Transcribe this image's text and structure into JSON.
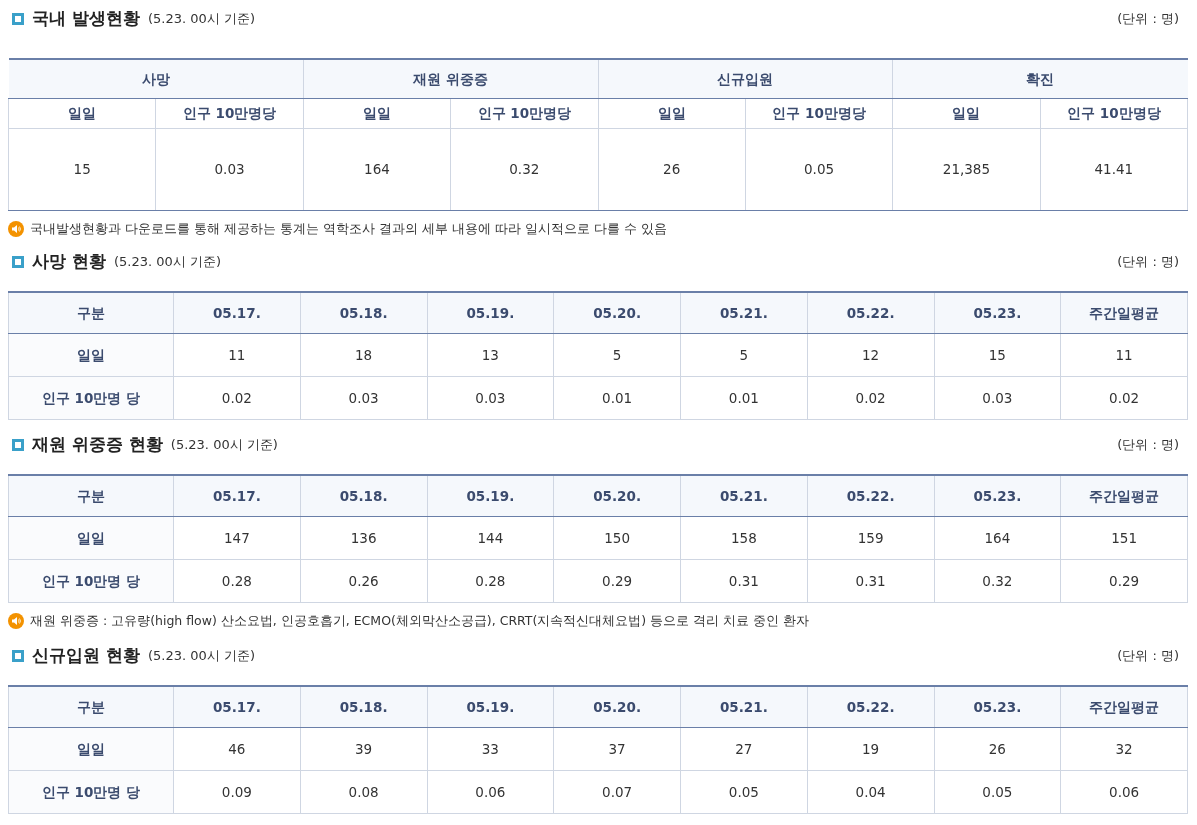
{
  "summary": {
    "title": "국내 발생현황",
    "subtitle": "(5.23. 00시 기준)",
    "unit": "(단위 : 명)",
    "groups": [
      {
        "label": "사망",
        "columns": [
          "일일",
          "인구 10만명당"
        ],
        "values": [
          "15",
          "0.03"
        ]
      },
      {
        "label": "재원 위중증",
        "columns": [
          "일일",
          "인구 10만명당"
        ],
        "values": [
          "164",
          "0.32"
        ]
      },
      {
        "label": "신규입원",
        "columns": [
          "일일",
          "인구 10만명당"
        ],
        "values": [
          "26",
          "0.05"
        ]
      },
      {
        "label": "확진",
        "columns": [
          "일일",
          "인구 10만명당"
        ],
        "values": [
          "21,385",
          "41.41"
        ]
      }
    ],
    "note": "국내발생현황과 다운로드를 통해 제공하는 통계는 역학조사 결과의 세부 내용에 따라 일시적으로 다를 수 있음"
  },
  "sections": [
    {
      "title": "사망 현황",
      "subtitle": "(5.23. 00시 기준)",
      "unit": "(단위 : 명)",
      "header": [
        "구분",
        "05.17.",
        "05.18.",
        "05.19.",
        "05.20.",
        "05.21.",
        "05.22.",
        "05.23.",
        "주간일평균"
      ],
      "rows": [
        {
          "label": "일일",
          "values": [
            "11",
            "18",
            "13",
            "5",
            "5",
            "12",
            "15",
            "11"
          ]
        },
        {
          "label": "인구 10만명 당",
          "values": [
            "0.02",
            "0.03",
            "0.03",
            "0.01",
            "0.01",
            "0.02",
            "0.03",
            "0.02"
          ]
        }
      ]
    },
    {
      "title": "재원 위중증 현황",
      "subtitle": "(5.23. 00시 기준)",
      "unit": "(단위 : 명)",
      "header": [
        "구분",
        "05.17.",
        "05.18.",
        "05.19.",
        "05.20.",
        "05.21.",
        "05.22.",
        "05.23.",
        "주간일평균"
      ],
      "rows": [
        {
          "label": "일일",
          "values": [
            "147",
            "136",
            "144",
            "150",
            "158",
            "159",
            "164",
            "151"
          ]
        },
        {
          "label": "인구 10만명 당",
          "values": [
            "0.28",
            "0.26",
            "0.28",
            "0.29",
            "0.31",
            "0.31",
            "0.32",
            "0.29"
          ]
        }
      ],
      "note": "재원 위중증 : 고유량(high flow) 산소요법, 인공호흡기, ECMO(체외막산소공급), CRRT(지속적신대체요법) 등으로 격리 치료 중인 환자"
    },
    {
      "title": "신규입원 현황",
      "subtitle": "(5.23. 00시 기준)",
      "unit": "(단위 : 명)",
      "header": [
        "구분",
        "05.17.",
        "05.18.",
        "05.19.",
        "05.20.",
        "05.21.",
        "05.22.",
        "05.23.",
        "주간일평균"
      ],
      "rows": [
        {
          "label": "일일",
          "values": [
            "46",
            "39",
            "33",
            "37",
            "27",
            "19",
            "26",
            "32"
          ]
        },
        {
          "label": "인구 10만명 당",
          "values": [
            "0.09",
            "0.08",
            "0.06",
            "0.07",
            "0.05",
            "0.04",
            "0.05",
            "0.06"
          ]
        }
      ]
    }
  ]
}
